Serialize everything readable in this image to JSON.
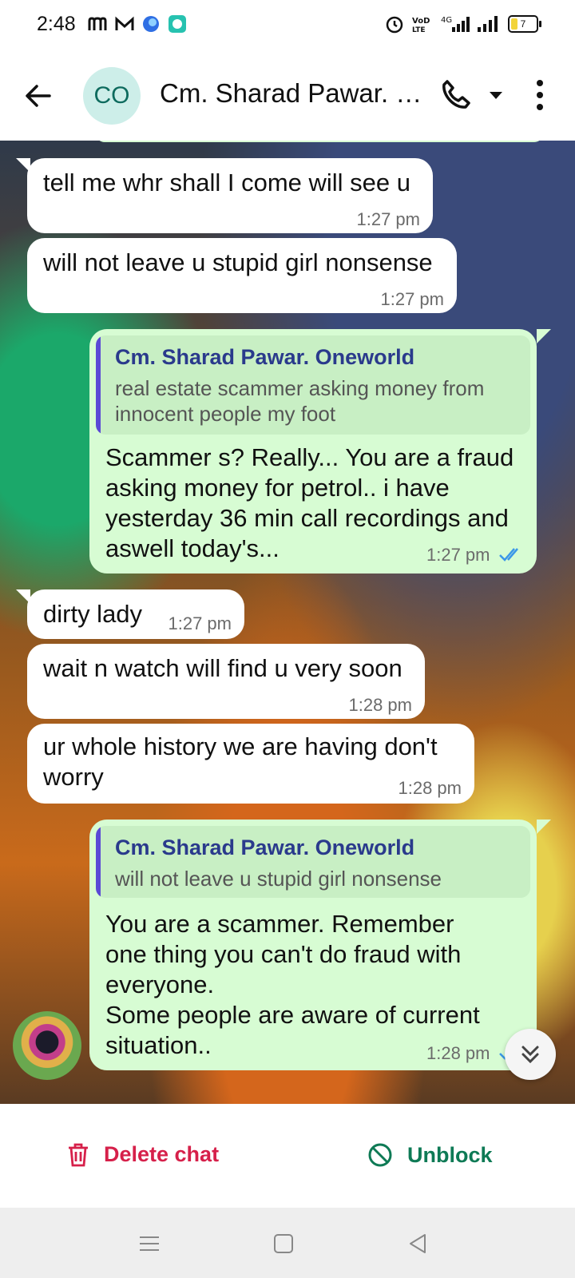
{
  "status_bar": {
    "time": "2:48",
    "battery_level": "7"
  },
  "header": {
    "avatar_initials": "CO",
    "title": "Cm. Sharad Pawar. O..."
  },
  "messages": [
    {
      "text": "tell me whr shall I come will see u",
      "time": "1:27 pm"
    },
    {
      "text": "will not leave u stupid girl nonsense",
      "time": "1:27 pm"
    },
    {
      "quote_author": "Cm. Sharad Pawar. Oneworld",
      "quote_line1": "real estate scammer asking money from",
      "quote_line2": "innocent people my foot",
      "line1": "Scammer s? Really... You are a fraud",
      "line2": "asking money for petrol.. i have",
      "line3": "yesterday 36 min call recordings and",
      "line4": "aswell today's...",
      "time": "1:27 pm"
    },
    {
      "text": "dirty lady",
      "time": "1:27 pm"
    },
    {
      "text": "wait n watch will find u very soon",
      "time": "1:28 pm"
    },
    {
      "line1": "ur whole history we are having don't",
      "line2": "worry",
      "time": "1:28 pm"
    },
    {
      "quote_author": "Cm. Sharad Pawar. Oneworld",
      "quote_line1": "will not leave u stupid girl nonsense",
      "line1": "You are a scammer. Remember",
      "line2": "one thing you can't do fraud with",
      "line3": "everyone.",
      "line4": "Some people are aware of current",
      "line5": "situation..",
      "time": "1:28 pm"
    }
  ],
  "actions": {
    "delete_label": "Delete chat",
    "unblock_label": "Unblock"
  },
  "colors": {
    "incoming_bubble": "#ffffff",
    "outgoing_bubble": "#d7fcd3",
    "delete": "#d6204a",
    "unblock": "#0e7a55",
    "read_ticks": "#3b97e8"
  }
}
